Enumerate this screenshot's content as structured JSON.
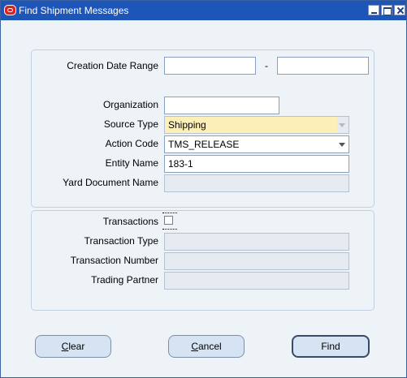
{
  "window": {
    "title": "Find Shipment Messages",
    "controls": [
      "minimize",
      "maximize",
      "close"
    ]
  },
  "colors": {
    "titlebar": "#1d56b8",
    "required_field": "#fcf0b8",
    "background": "#eef3f8"
  },
  "criteria": {
    "creation_date_range": {
      "label": "Creation Date Range",
      "from": "",
      "to": "",
      "separator": "-"
    },
    "organization": {
      "label": "Organization",
      "value": ""
    },
    "source_type": {
      "label": "Source Type",
      "value": "Shipping"
    },
    "action_code": {
      "label": "Action  Code",
      "value": "TMS_RELEASE"
    },
    "entity_name": {
      "label": "Entity Name",
      "value": "183-1"
    },
    "yard_document_name": {
      "label": "Yard Document Name",
      "value": ""
    }
  },
  "transactions": {
    "transactions": {
      "label": "Transactions",
      "checked": false
    },
    "transaction_type": {
      "label": "Transaction Type",
      "value": ""
    },
    "transaction_number": {
      "label": "Transaction Number",
      "value": ""
    },
    "trading_partner": {
      "label": "Trading Partner",
      "value": ""
    }
  },
  "buttons": {
    "clear": {
      "mnemonic": "C",
      "rest": "lear"
    },
    "cancel": {
      "mnemonic": "C",
      "rest": "ancel"
    },
    "find": {
      "label": "Find"
    }
  }
}
